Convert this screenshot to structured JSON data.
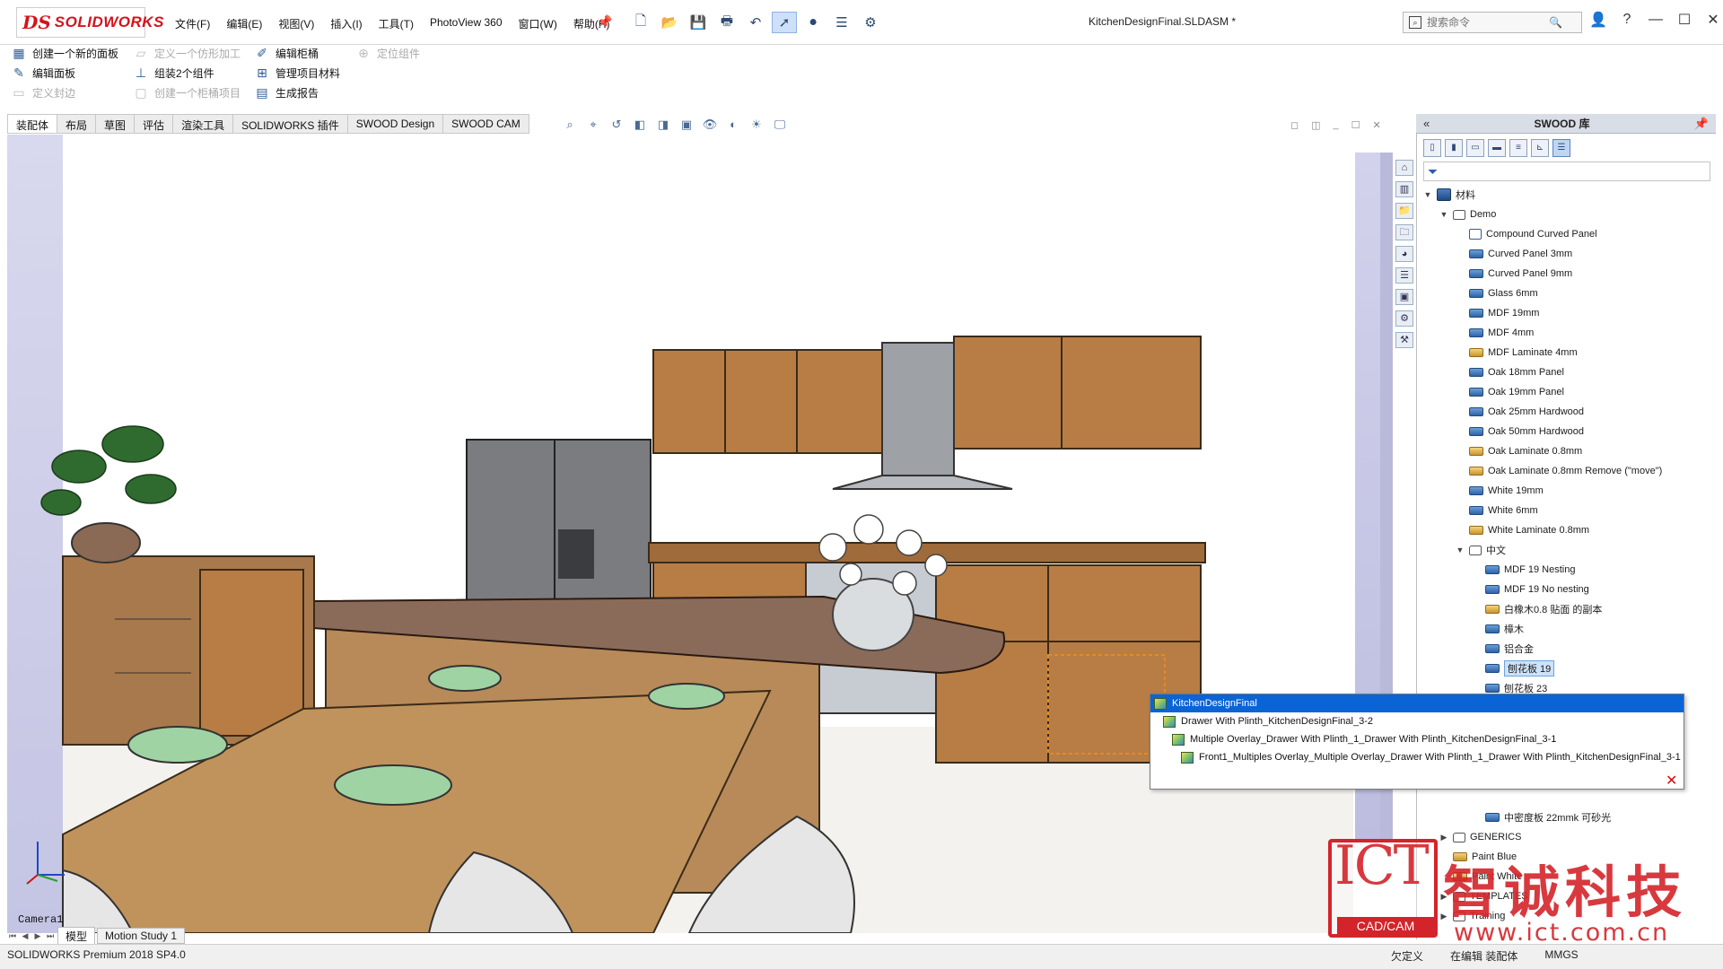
{
  "title_bar": {
    "brand_mark": "DS",
    "brand_name": "SOLIDWORKS",
    "document_title": "KitchenDesignFinal.SLDASM *",
    "search_placeholder": "搜索命令",
    "menu": [
      "文件(F)",
      "编辑(E)",
      "视图(V)",
      "插入(I)",
      "工具(T)",
      "PhotoView 360",
      "窗口(W)",
      "帮助(H)"
    ],
    "pin_icon": "pin-icon",
    "quick_access_icons": [
      "new-doc-icon",
      "open-icon",
      "save-icon",
      "print-icon",
      "undo-icon",
      "select-icon",
      "traffic-light-icon",
      "file-props-icon",
      "options-icon"
    ],
    "window_controls": [
      "user-icon",
      "help-icon",
      "minimize-icon",
      "maximize-icon",
      "close-icon"
    ]
  },
  "command_manager": {
    "col1": [
      {
        "label": "创建一个新的面板",
        "enabled": true
      },
      {
        "label": "编辑面板",
        "enabled": true
      },
      {
        "label": "定义封边",
        "enabled": false
      }
    ],
    "col2": [
      {
        "label": "定义一个仿形加工",
        "enabled": false
      },
      {
        "label": "组装2个组件",
        "enabled": true
      },
      {
        "label": "创建一个柜桶项目",
        "enabled": false
      }
    ],
    "col3": [
      {
        "label": "编辑柜桶",
        "enabled": true
      },
      {
        "label": "管理项目材料",
        "enabled": true
      },
      {
        "label": "生成报告",
        "enabled": true
      }
    ],
    "col4": [
      {
        "label": "定位组件",
        "enabled": false
      }
    ]
  },
  "tabs": [
    {
      "label": "装配体",
      "active": true
    },
    {
      "label": "布局",
      "active": false
    },
    {
      "label": "草图",
      "active": false
    },
    {
      "label": "评估",
      "active": false
    },
    {
      "label": "渲染工具",
      "active": false
    },
    {
      "label": "SOLIDWORKS 插件",
      "active": false
    },
    {
      "label": "SWOOD Design",
      "active": false
    },
    {
      "label": "SWOOD CAM",
      "active": false
    }
  ],
  "viewport": {
    "camera_label": "Camera1",
    "model_tabs": [
      {
        "label": "模型",
        "active": true
      },
      {
        "label": "Motion Study 1",
        "active": false
      }
    ]
  },
  "status_bar": {
    "app": "SOLIDWORKS Premium 2018 SP4.0",
    "state": "欠定义",
    "mode": "在编辑 装配体",
    "units": "MMGS"
  },
  "swood_library": {
    "title": "SWOOD 库",
    "tree": [
      {
        "label": "材料",
        "level": 0,
        "icon": "root",
        "exp": "▼"
      },
      {
        "label": "Demo",
        "level": 1,
        "icon": "folder",
        "exp": "▼"
      },
      {
        "label": "Compound Curved Panel",
        "level": 2,
        "icon": "panel"
      },
      {
        "label": "Curved Panel 3mm",
        "level": 2,
        "icon": "mat-blue"
      },
      {
        "label": "Curved Panel 9mm",
        "level": 2,
        "icon": "mat-blue"
      },
      {
        "label": "Glass 6mm",
        "level": 2,
        "icon": "mat-blue"
      },
      {
        "label": "MDF 19mm",
        "level": 2,
        "icon": "mat-blue"
      },
      {
        "label": "MDF 4mm",
        "level": 2,
        "icon": "mat-blue"
      },
      {
        "label": "MDF Laminate 4mm",
        "level": 2,
        "icon": "mat-gold"
      },
      {
        "label": "Oak 18mm Panel",
        "level": 2,
        "icon": "mat-blue"
      },
      {
        "label": "Oak 19mm Panel",
        "level": 2,
        "icon": "mat-blue"
      },
      {
        "label": "Oak 25mm Hardwood",
        "level": 2,
        "icon": "mat-blue"
      },
      {
        "label": "Oak 50mm Hardwood",
        "level": 2,
        "icon": "mat-blue"
      },
      {
        "label": "Oak Laminate 0.8mm",
        "level": 2,
        "icon": "mat-gold"
      },
      {
        "label": "Oak Laminate 0.8mm Remove (\"move\")",
        "level": 2,
        "icon": "mat-gold"
      },
      {
        "label": "White 19mm",
        "level": 2,
        "icon": "mat-blue"
      },
      {
        "label": "White 6mm",
        "level": 2,
        "icon": "mat-blue"
      },
      {
        "label": "White Laminate 0.8mm",
        "level": 2,
        "icon": "mat-gold"
      },
      {
        "label": "中文",
        "level": 2,
        "icon": "folder",
        "exp": "▼"
      },
      {
        "label": "MDF 19  Nesting",
        "level": 3,
        "icon": "mat-blue"
      },
      {
        "label": "MDF 19 No nesting",
        "level": 3,
        "icon": "mat-blue"
      },
      {
        "label": "白橡木0.8 贴面 的副本",
        "level": 3,
        "icon": "mat-gold"
      },
      {
        "label": "樟木",
        "level": 3,
        "icon": "mat-blue"
      },
      {
        "label": "铝合金",
        "level": 3,
        "icon": "mat-blue"
      },
      {
        "label": "刨花板 19",
        "level": 3,
        "icon": "mat-blue",
        "selected": true
      },
      {
        "label": "刨花板 23",
        "level": 3,
        "icon": "mat-blue"
      }
    ],
    "tree_bottom": [
      {
        "label": "中密度板 22mmk 可砂光",
        "level": 3,
        "icon": "mat-blue"
      },
      {
        "label": "GENERICS",
        "level": 1,
        "icon": "folder",
        "exp": "▶"
      },
      {
        "label": "Paint Blue",
        "level": 1,
        "icon": "mat-gold"
      },
      {
        "label": "Paint White",
        "level": 1,
        "icon": "mat-gold"
      },
      {
        "label": "TEMPLATES",
        "level": 1,
        "icon": "folder",
        "exp": "▶"
      },
      {
        "label": "Training",
        "level": 1,
        "icon": "folder",
        "exp": "▶"
      }
    ]
  },
  "selection_popup": {
    "items": [
      {
        "label": "KitchenDesignFinal",
        "indent": 0,
        "selected": true
      },
      {
        "label": "Drawer With Plinth_KitchenDesignFinal_3-2",
        "indent": 1
      },
      {
        "label": "Multiple Overlay_Drawer With Plinth_1_Drawer With Plinth_KitchenDesignFinal_3-1",
        "indent": 2
      },
      {
        "label": "Front1_Multiples Overlay_Multiple Overlay_Drawer With Plinth_1_Drawer With Plinth_KitchenDesignFinal_3-1",
        "indent": 3
      }
    ],
    "close_icon": "close-icon"
  },
  "watermark": {
    "brand": "ICT",
    "sub": "CAD/CAM",
    "name": "智诚科技",
    "url": "www.ict.com.cn"
  }
}
